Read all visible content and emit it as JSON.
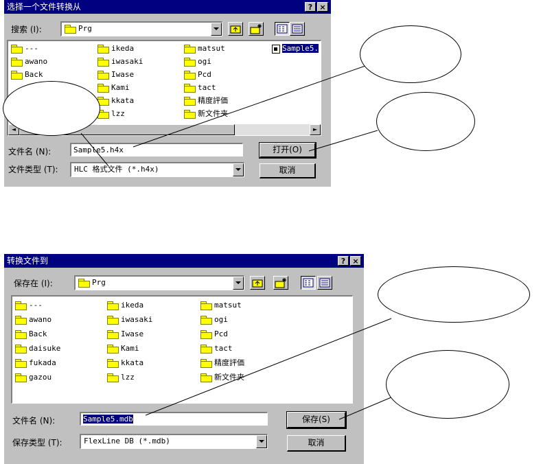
{
  "open_dialog": {
    "title": "选择一个文件转换从",
    "help_glyph": "?",
    "close_glyph": "×",
    "lookin_label": "搜索 (I):",
    "lookin_value": "Prg",
    "folders": [
      "---",
      "awano",
      "Back",
      "",
      "",
      "",
      "ikeda",
      "iwasaki",
      "Iwase",
      "Kami",
      "kkata",
      "lzz",
      "matsut",
      "ogi",
      "Pcd",
      "tact",
      "精度評価",
      "新文件夹"
    ],
    "partial_folders": [
      "",
      "",
      ""
    ],
    "file_item": "Sample5.h4x",
    "file_item_visible": "Sample5.",
    "filename_label": "文件名 (N):",
    "filename_value": "Sample5.h4x",
    "filetype_label": "文件类型 (T):",
    "filetype_value": "HLC 格式文件 (*.h4x)",
    "open_button": "打开(O)",
    "cancel_button": "取消",
    "scroll_left": "◄",
    "scroll_right": "►"
  },
  "save_dialog": {
    "title": "转换文件到",
    "help_glyph": "?",
    "close_glyph": "×",
    "savein_label": "保存在 (I):",
    "savein_value": "Prg",
    "col1": [
      "---",
      "awano",
      "Back",
      "daisuke",
      "fukada",
      "gazou"
    ],
    "col2": [
      "ikeda",
      "iwasaki",
      "Iwase",
      "Kami",
      "kkata",
      "lzz"
    ],
    "col3": [
      "matsut",
      "ogi",
      "Pcd",
      "tact",
      "精度評価",
      "新文件夹"
    ],
    "filename_label": "文件名 (N):",
    "filename_value": "Sample5.mdb",
    "savetype_label": "保存类型 (T):",
    "savetype_value": "FlexLine DB (*.mdb)",
    "save_button": "保存(S)",
    "cancel_button": "取消"
  },
  "icons": {
    "folder": "folder-icon",
    "up": "up-folder-icon",
    "new": "new-folder-icon",
    "list": "list-view-icon",
    "details": "details-view-icon"
  },
  "colors": {
    "titlebar": "#000080",
    "face": "#c0c0c0",
    "selection": "#000080"
  }
}
